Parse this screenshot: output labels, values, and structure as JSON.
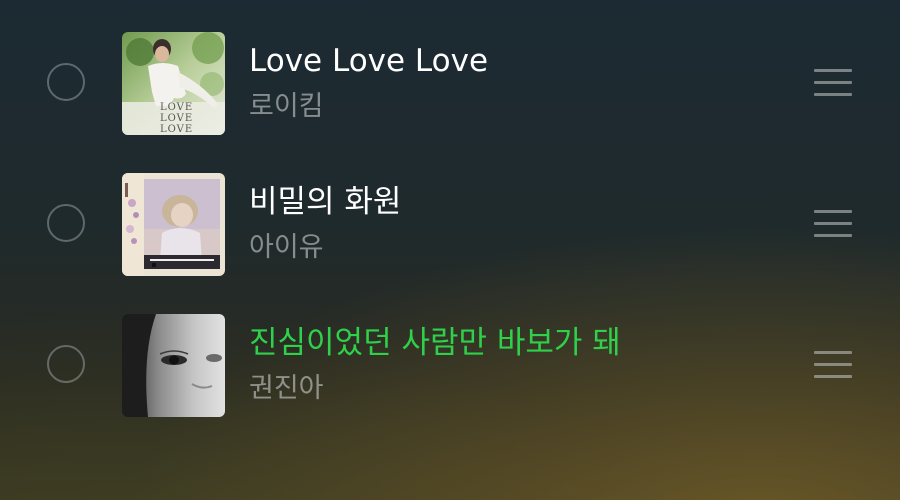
{
  "playlist": {
    "tracks": [
      {
        "title": "Love Love Love",
        "artist": "로이킴",
        "album_art_text": [
          "LOVE",
          "LOVE",
          "LOVE"
        ],
        "playing": false,
        "selected": false
      },
      {
        "title": "비밀의 화원",
        "artist": "아이유",
        "playing": false,
        "selected": false
      },
      {
        "title": "진심이었던 사람만 바보가 돼",
        "artist": "권진아",
        "playing": true,
        "selected": false
      }
    ]
  },
  "colors": {
    "title": "#ffffff",
    "now_playing_title": "#2fd04a",
    "artist": "#9a9c9e",
    "handle": "#a0a0a0"
  },
  "icons": {
    "select": "empty-circle",
    "reorder": "drag-handle-icon"
  }
}
